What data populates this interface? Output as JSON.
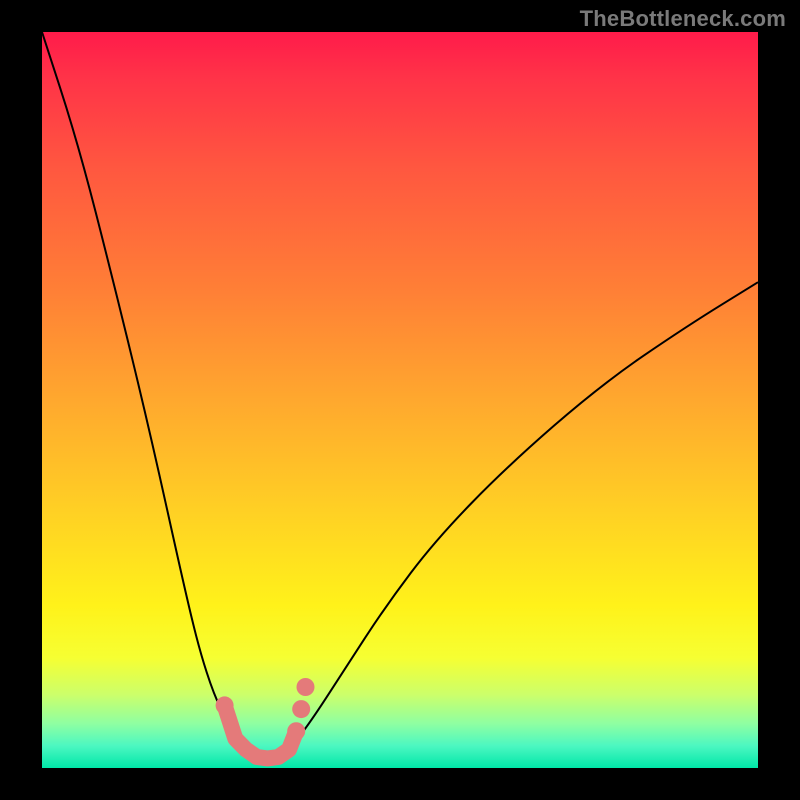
{
  "watermark": "TheBottleneck.com",
  "chart_data": {
    "type": "line",
    "title": "",
    "xlabel": "",
    "ylabel": "",
    "xlim": [
      0,
      100
    ],
    "ylim": [
      0,
      100
    ],
    "grid": false,
    "legend": false,
    "series": [
      {
        "name": "bottleneck-curve",
        "x": [
          0,
          5,
          10,
          15,
          20,
          22,
          24,
          26,
          28,
          29,
          30,
          31,
          32,
          33,
          34,
          35,
          38,
          42,
          48,
          55,
          65,
          78,
          90,
          100
        ],
        "y": [
          100,
          85,
          66,
          46,
          24,
          16,
          10,
          6,
          3,
          2,
          1.5,
          1,
          1,
          1.5,
          2,
          3,
          7,
          13,
          22,
          31,
          41,
          52,
          60,
          66
        ]
      }
    ],
    "markers": {
      "name": "highlighted-region",
      "color": "#e47a7a",
      "points_xy": [
        [
          25.5,
          8.5
        ],
        [
          27.0,
          4.0
        ],
        [
          28.5,
          2.5
        ],
        [
          30.0,
          1.5
        ],
        [
          31.5,
          1.3
        ],
        [
          33.0,
          1.5
        ],
        [
          34.5,
          2.5
        ],
        [
          35.5,
          5.0
        ],
        [
          36.2,
          8.0
        ],
        [
          36.8,
          11.0
        ]
      ]
    },
    "background_gradient": {
      "top": "#ff1b4a",
      "bottom": "#00e7a8",
      "direction": "vertical"
    }
  }
}
